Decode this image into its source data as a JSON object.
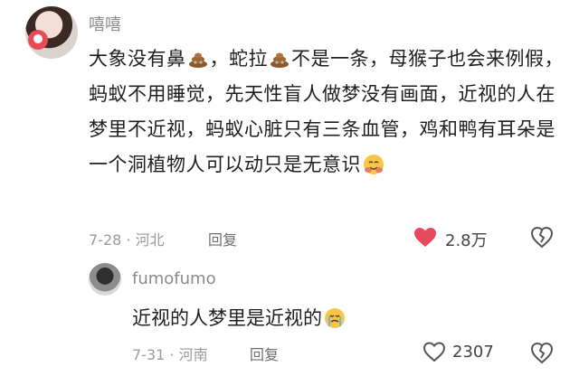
{
  "comment_main": {
    "username": "嘻嘻",
    "text_parts": {
      "p1": "大象没有鼻",
      "p2": "，蛇拉",
      "p3": "不是一条，母猴子也会来例假，蚂蚁不用睡觉，先天性盲人做梦没有画面，近视的人在梦里不近视，蚂蚁心脏只有三条血管，鸡和鸭有耳朵是一个洞植物人可以动只是无意识"
    },
    "date_location": "7-28 · 河北",
    "reply_label": "回复",
    "likes": "2.8万"
  },
  "reply": {
    "username": "fumofumo",
    "text": "近视的人梦里是近视的",
    "date_location": "7-31 · 河南",
    "reply_label": "回复",
    "likes": "2307"
  },
  "icons": {
    "liked_heart": "heart-filled-icon",
    "unliked_heart": "heart-outline-icon",
    "broken_heart": "broken-heart-icon",
    "poop": "poop-emoji",
    "hug": "hug-emoji",
    "cry": "crying-emoji"
  },
  "colors": {
    "like_red": "#e64a5c",
    "meta_gray": "#9a9a9a"
  }
}
